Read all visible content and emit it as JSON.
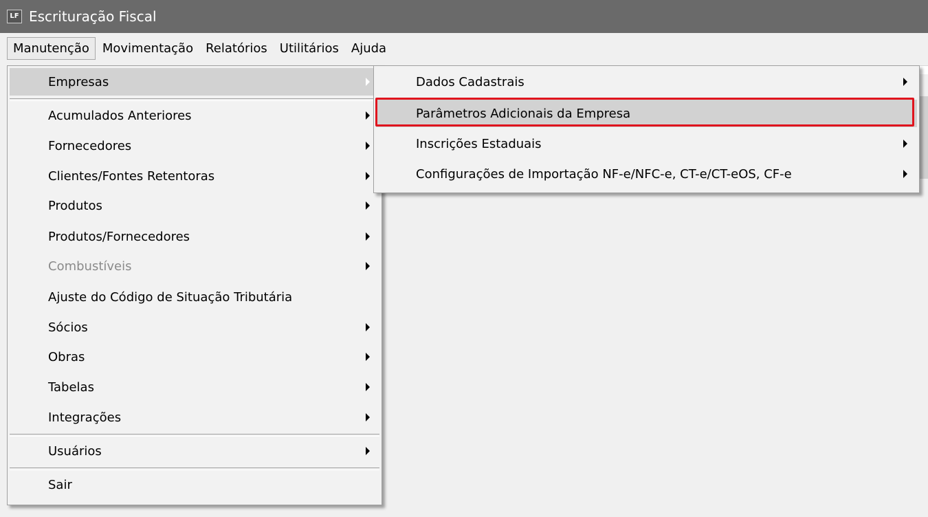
{
  "window": {
    "title": "Escrituração Fiscal",
    "icon_text": "LF",
    "icon": "app-logo-icon"
  },
  "menubar": {
    "items": [
      "Manutenção",
      "Movimentação",
      "Relatórios",
      "Utilitários",
      "Ajuda"
    ],
    "active": "Manutenção"
  },
  "manutencao_menu": {
    "items": [
      {
        "label": "Empresas",
        "submenu": true,
        "highlighted": true
      },
      {
        "label": "Acumulados Anteriores",
        "submenu": true
      },
      {
        "label": "Fornecedores",
        "submenu": true
      },
      {
        "label": "Clientes/Fontes Retentoras",
        "submenu": true
      },
      {
        "label": "Produtos",
        "submenu": true
      },
      {
        "label": "Produtos/Fornecedores",
        "submenu": true
      },
      {
        "label": "Combustíveis",
        "submenu": true,
        "disabled": true
      },
      {
        "label": "Ajuste do Código de Situação Tributária",
        "submenu": false
      },
      {
        "label": "Sócios",
        "submenu": true
      },
      {
        "label": "Obras",
        "submenu": true
      },
      {
        "label": "Tabelas",
        "submenu": true
      },
      {
        "label": "Integrações",
        "submenu": true
      },
      {
        "label": "Usuários",
        "submenu": true
      },
      {
        "label": "Sair",
        "submenu": false
      }
    ]
  },
  "empresas_submenu": {
    "items": [
      {
        "label": "Dados Cadastrais",
        "submenu": true
      },
      {
        "label": "Parâmetros Adicionais da Empresa",
        "submenu": false,
        "highlighted": true,
        "marked": true
      },
      {
        "label": "Inscrições Estaduais",
        "submenu": true
      },
      {
        "label": "Configurações de Importação NF-e/NFC-e, CT-e/CT-eOS, CF-e",
        "submenu": true
      }
    ]
  },
  "colors": {
    "titlebar": "#6a6a6a",
    "menu_bg": "#f2f2f2",
    "highlight": "#d2d2d2",
    "marker": "#e0141e"
  }
}
